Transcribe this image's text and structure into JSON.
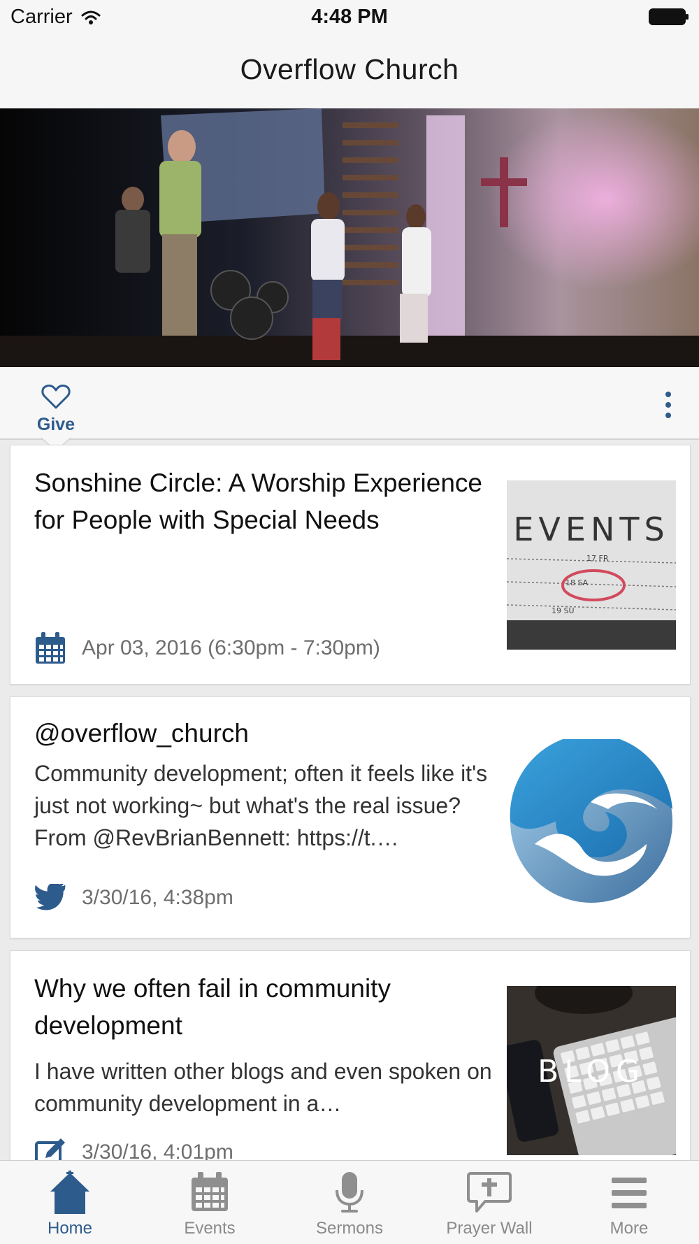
{
  "status_bar": {
    "carrier": "Carrier",
    "time": "4:48 PM"
  },
  "nav": {
    "title": "Overflow Church"
  },
  "hero": {
    "alt_icon": "worship-stage-photo"
  },
  "actions": {
    "give_label": "Give",
    "more_icon": "kebab-icon"
  },
  "feed": [
    {
      "type": "event",
      "title": "Sonshine Circle: A Worship Experience for People with Special Needs",
      "meta": "Apr 03, 2016 (6:30pm - 7:30pm)",
      "icon": "calendar-icon",
      "thumb_label": "EVENTS",
      "thumb_dates": [
        "17 FR",
        "18 SA",
        "19 SU"
      ]
    },
    {
      "type": "tweet",
      "title": "@overflow_church",
      "body": "Community development; often it feels like it's just not working~ but what's the real issue? From @RevBrianBennett: https://t.…",
      "meta": "3/30/16, 4:38pm",
      "icon": "twitter-icon"
    },
    {
      "type": "blog",
      "title": "Why we often fail in community development",
      "body": "I have written other blogs and even spoken on community development in a…",
      "meta": "3/30/16, 4:01pm",
      "icon": "edit-icon",
      "thumb_label": "BLOG"
    }
  ],
  "tabs": [
    {
      "label": "Home",
      "icon": "home-icon",
      "active": true
    },
    {
      "label": "Events",
      "icon": "calendar-icon",
      "active": false
    },
    {
      "label": "Sermons",
      "icon": "microphone-icon",
      "active": false
    },
    {
      "label": "Prayer Wall",
      "icon": "prayer-cross-icon",
      "active": false
    },
    {
      "label": "More",
      "icon": "menu-icon",
      "active": false
    }
  ],
  "colors": {
    "accent": "#2d5b8c",
    "tab_inactive": "#8a8a8a",
    "background": "#ebebeb"
  }
}
